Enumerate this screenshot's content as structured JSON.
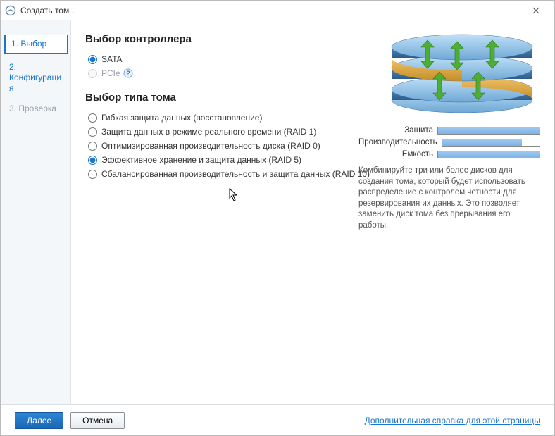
{
  "window": {
    "title": "Создать том..."
  },
  "sidebar": {
    "steps": [
      {
        "label": "1. Выбор"
      },
      {
        "label": "2. Конфигурация"
      },
      {
        "label": "3. Проверка"
      }
    ]
  },
  "controller": {
    "heading": "Выбор контроллера",
    "options": [
      {
        "label": "SATA",
        "selected": true,
        "enabled": true
      },
      {
        "label": "PCIe",
        "selected": false,
        "enabled": false
      }
    ]
  },
  "volume_type": {
    "heading": "Выбор типа тома",
    "options": [
      {
        "label": "Гибкая защита данных (восстановление)",
        "selected": false
      },
      {
        "label": "Защита данных в режиме реального времени (RAID 1)",
        "selected": false
      },
      {
        "label": "Оптимизированная производительность диска (RAID 0)",
        "selected": false
      },
      {
        "label": "Эффективное хранение и защита данных (RAID 5)",
        "selected": true
      },
      {
        "label": "Сбалансированная производительность и защита данных (RAID 10)",
        "selected": false
      }
    ]
  },
  "info": {
    "meters": [
      {
        "label": "Защита",
        "percent": 100
      },
      {
        "label": "Производительность",
        "percent": 82
      },
      {
        "label": "Емкость",
        "percent": 100
      }
    ],
    "description": "Комбинируйте три или более дисков для создания тома, который будет использовать распределение с контролем четности для резервирования их данных. Это позволяет заменить диск тома без прерывания его работы."
  },
  "footer": {
    "next": "Далее",
    "cancel": "Отмена",
    "help_link": "Дополнительная справка для этой страницы"
  },
  "colors": {
    "accent": "#1a75cf",
    "meter_fill": "#8bbce8"
  }
}
